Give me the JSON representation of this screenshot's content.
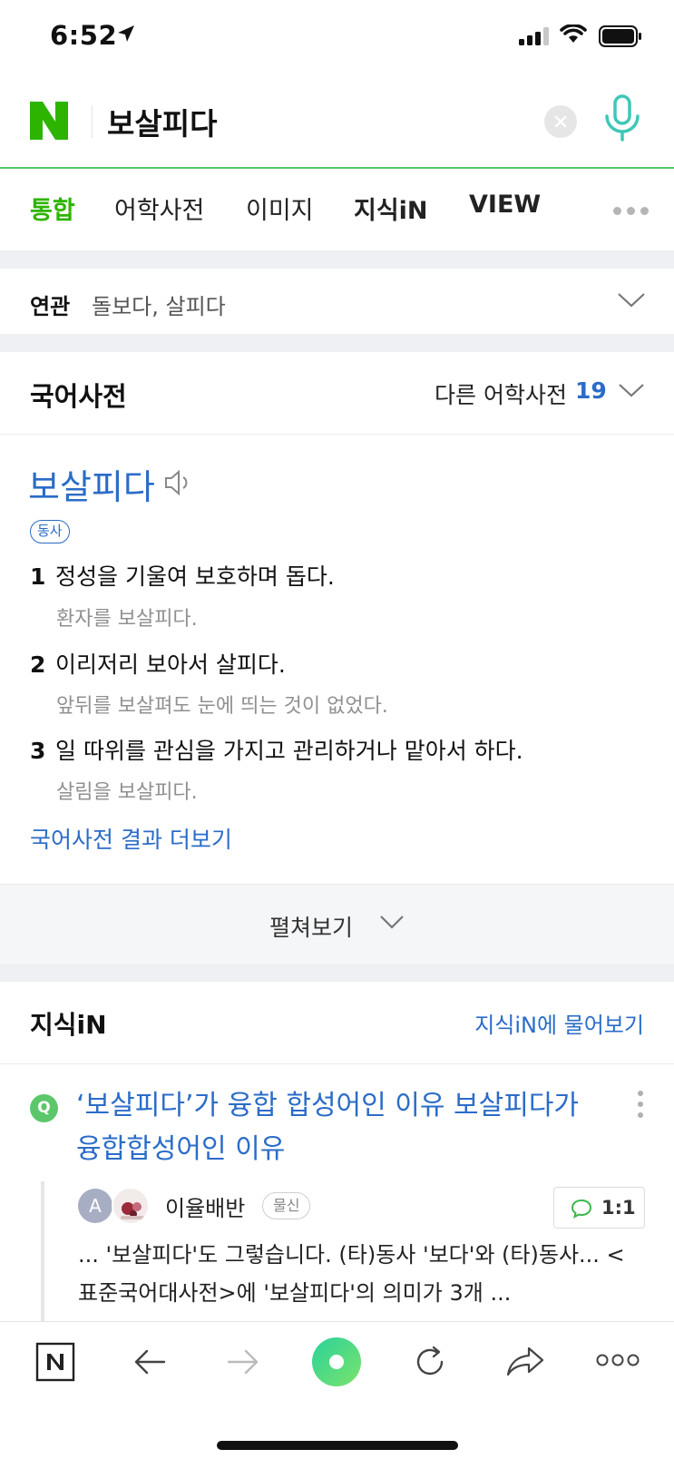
{
  "status_bar": {
    "time": "6:52"
  },
  "search": {
    "query": "보살피다"
  },
  "tabs": [
    {
      "label": "통합",
      "active": true
    },
    {
      "label": "어학사전"
    },
    {
      "label": "이미지"
    },
    {
      "label": "지식iN"
    },
    {
      "label": "VIEW"
    }
  ],
  "related": {
    "label": "연관",
    "terms": "돌보다, 살피다"
  },
  "dictionary": {
    "title": "국어사전",
    "other_dicts_label": "다른 어학사전",
    "other_dicts_count": "19",
    "headword": "보살피다",
    "part_of_speech": "동사",
    "senses": [
      {
        "num": "1",
        "definition": "정성을 기울여 보호하며 돕다.",
        "example": "환자를 보살피다."
      },
      {
        "num": "2",
        "definition": "이리저리 보아서 살피다.",
        "example": "앞뒤를 보살펴도 눈에 띄는 것이 없었다."
      },
      {
        "num": "3",
        "definition": "일 따위를 관심을 가지고 관리하거나 맡아서 하다.",
        "example": "살림을 보살피다."
      }
    ],
    "more_link": "국어사전 결과 더보기",
    "expand_label": "펼쳐보기"
  },
  "kin": {
    "title": "지식iN",
    "ask_link": "지식iN에 물어보기",
    "question_icon": "Q",
    "question": "‘보살피다’가 융합 합성어인 이유 보살피다가 융합합성어인 이유",
    "avatar_letter": "A",
    "username": "이율배반",
    "user_badge": "물신",
    "answer_count": "1:1",
    "snippet": "... '보살피다'도 그렇습니다. (타)동사 '보다'와 (타)동사... <표준국어대사전>에 '보살피다'의 의미가 3개 ..."
  },
  "colors": {
    "naver_green": "#2db400",
    "link_blue": "#2b6cc8",
    "mic_accent": "#3ec7b8"
  },
  "toolbar_icons": [
    "naver-home-icon",
    "back-arrow-icon",
    "forward-arrow-icon",
    "green-dot-icon",
    "reload-icon",
    "share-icon",
    "more-icon"
  ]
}
